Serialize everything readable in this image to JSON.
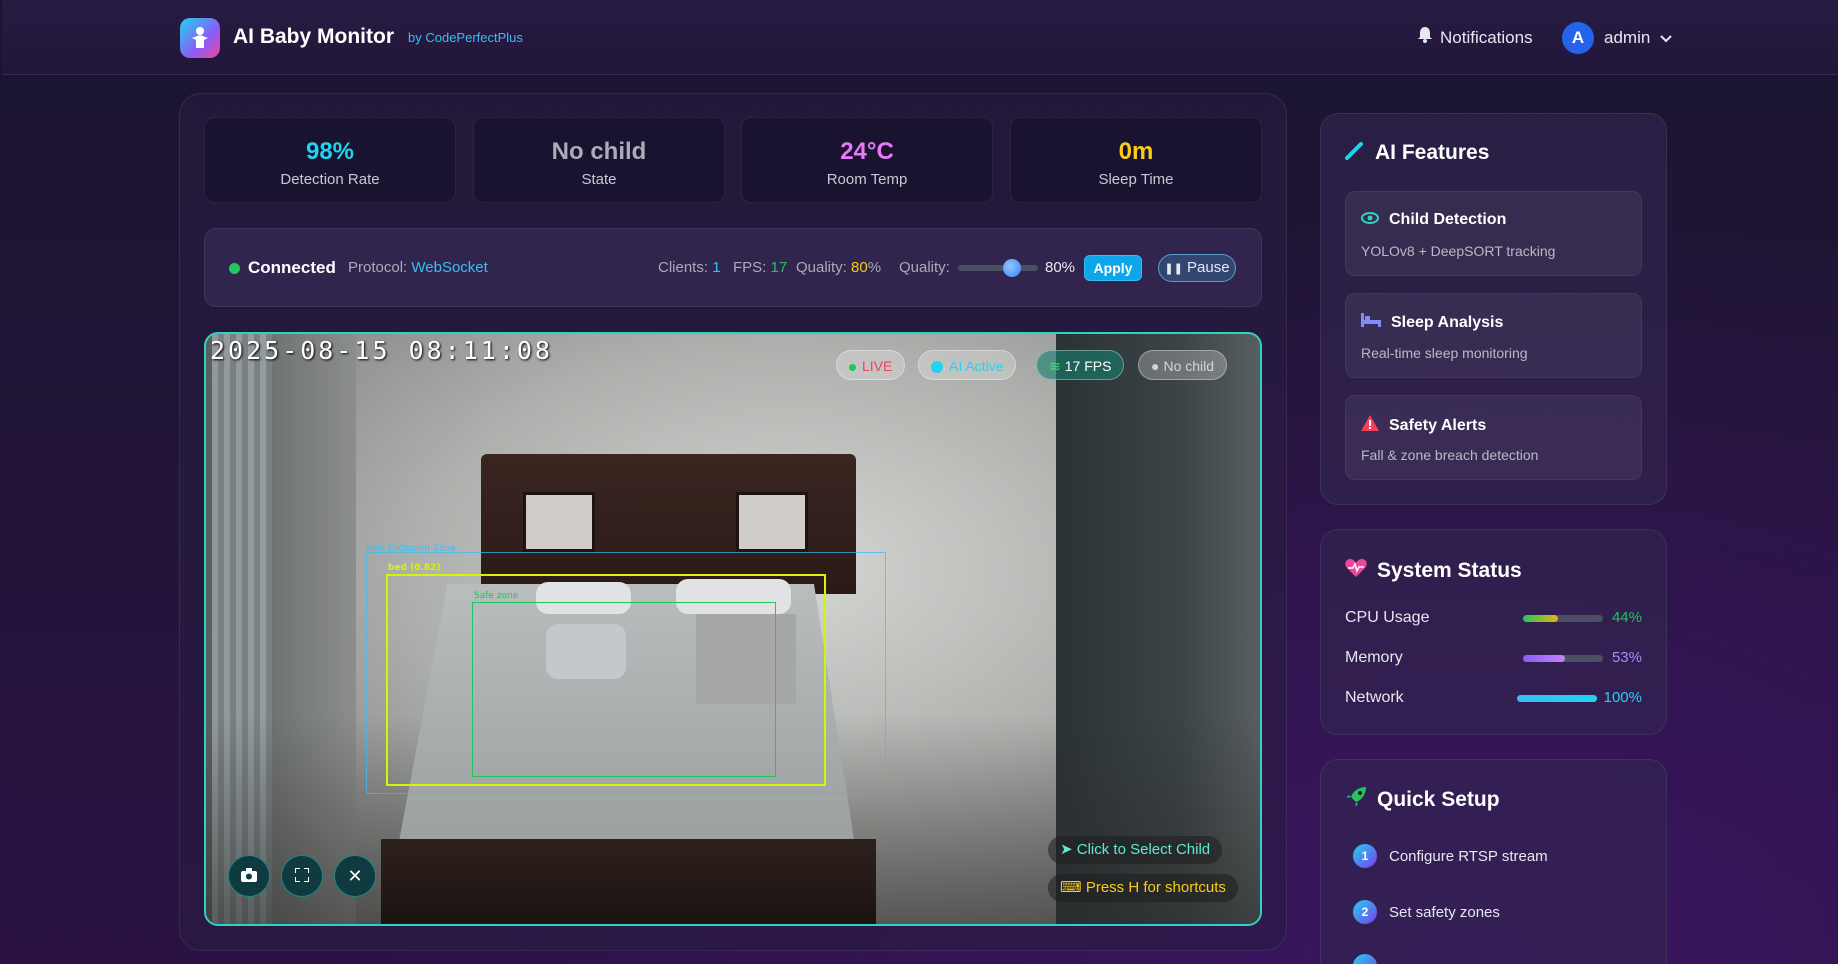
{
  "header": {
    "title": "AI Baby Monitor",
    "subtitle": "by CodePerfectPlus",
    "notifications_label": "Notifications",
    "user": {
      "initial": "A",
      "name": "admin"
    }
  },
  "stats": [
    {
      "value": "98%",
      "label": "Detection Rate",
      "color": "#22d3ee"
    },
    {
      "value": "No child",
      "label": "State",
      "color": "#a9acbb"
    },
    {
      "value": "24°C",
      "label": "Room Temp",
      "color": "#e879f9"
    },
    {
      "value": "0m",
      "label": "Sleep Time",
      "color": "#facc15"
    }
  ],
  "connection": {
    "status": "Connected",
    "protocol_label": "Protocol:",
    "protocol_value": "WebSocket",
    "clients_label": "Clients:",
    "clients_value": "1",
    "fps_label": "FPS:",
    "fps_value": "17",
    "quality_label": "Quality:",
    "quality_value": "80",
    "quality_unit": "%",
    "slider_label": "Quality:",
    "slider_value": "80%",
    "apply_label": "Apply",
    "pause_label": "Pause",
    "quality_level": 0.8
  },
  "video": {
    "timestamp": "2025-08-15  08:11:08",
    "chips": {
      "live": "LIVE",
      "ai": "AI Active",
      "fps": "17 FPS",
      "child": "No child"
    },
    "bbox_labels": {
      "bed": "bed (0.82)",
      "safe": "Safe zone",
      "outer": "Risk Exclusion Zone"
    },
    "hints": {
      "select": "Click to Select Child",
      "shortcuts": "Press H for shortcuts"
    }
  },
  "features": {
    "title": "AI Features",
    "items": [
      {
        "title": "Child Detection",
        "desc": "YOLOv8 + DeepSORT tracking"
      },
      {
        "title": "Sleep Analysis",
        "desc": "Real-time sleep monitoring"
      },
      {
        "title": "Safety Alerts",
        "desc": "Fall & zone breach detection"
      }
    ]
  },
  "system": {
    "title": "System Status",
    "rows": [
      {
        "label": "CPU Usage",
        "value": "44%",
        "level": 0.44,
        "color": "#84cc16"
      },
      {
        "label": "Memory",
        "value": "53%",
        "level": 0.53,
        "color": "#a78bfa"
      },
      {
        "label": "Network",
        "value": "100%",
        "level": 1.0,
        "color": "#22d3ee"
      }
    ]
  },
  "setup": {
    "title": "Quick Setup",
    "steps": [
      {
        "num": "1",
        "label": "Configure RTSP stream"
      },
      {
        "num": "2",
        "label": "Set safety zones"
      }
    ]
  },
  "colors": {
    "accent_cyan": "#22d3ee",
    "live_red": "#f43f5e",
    "ok_green": "#22c55e"
  }
}
